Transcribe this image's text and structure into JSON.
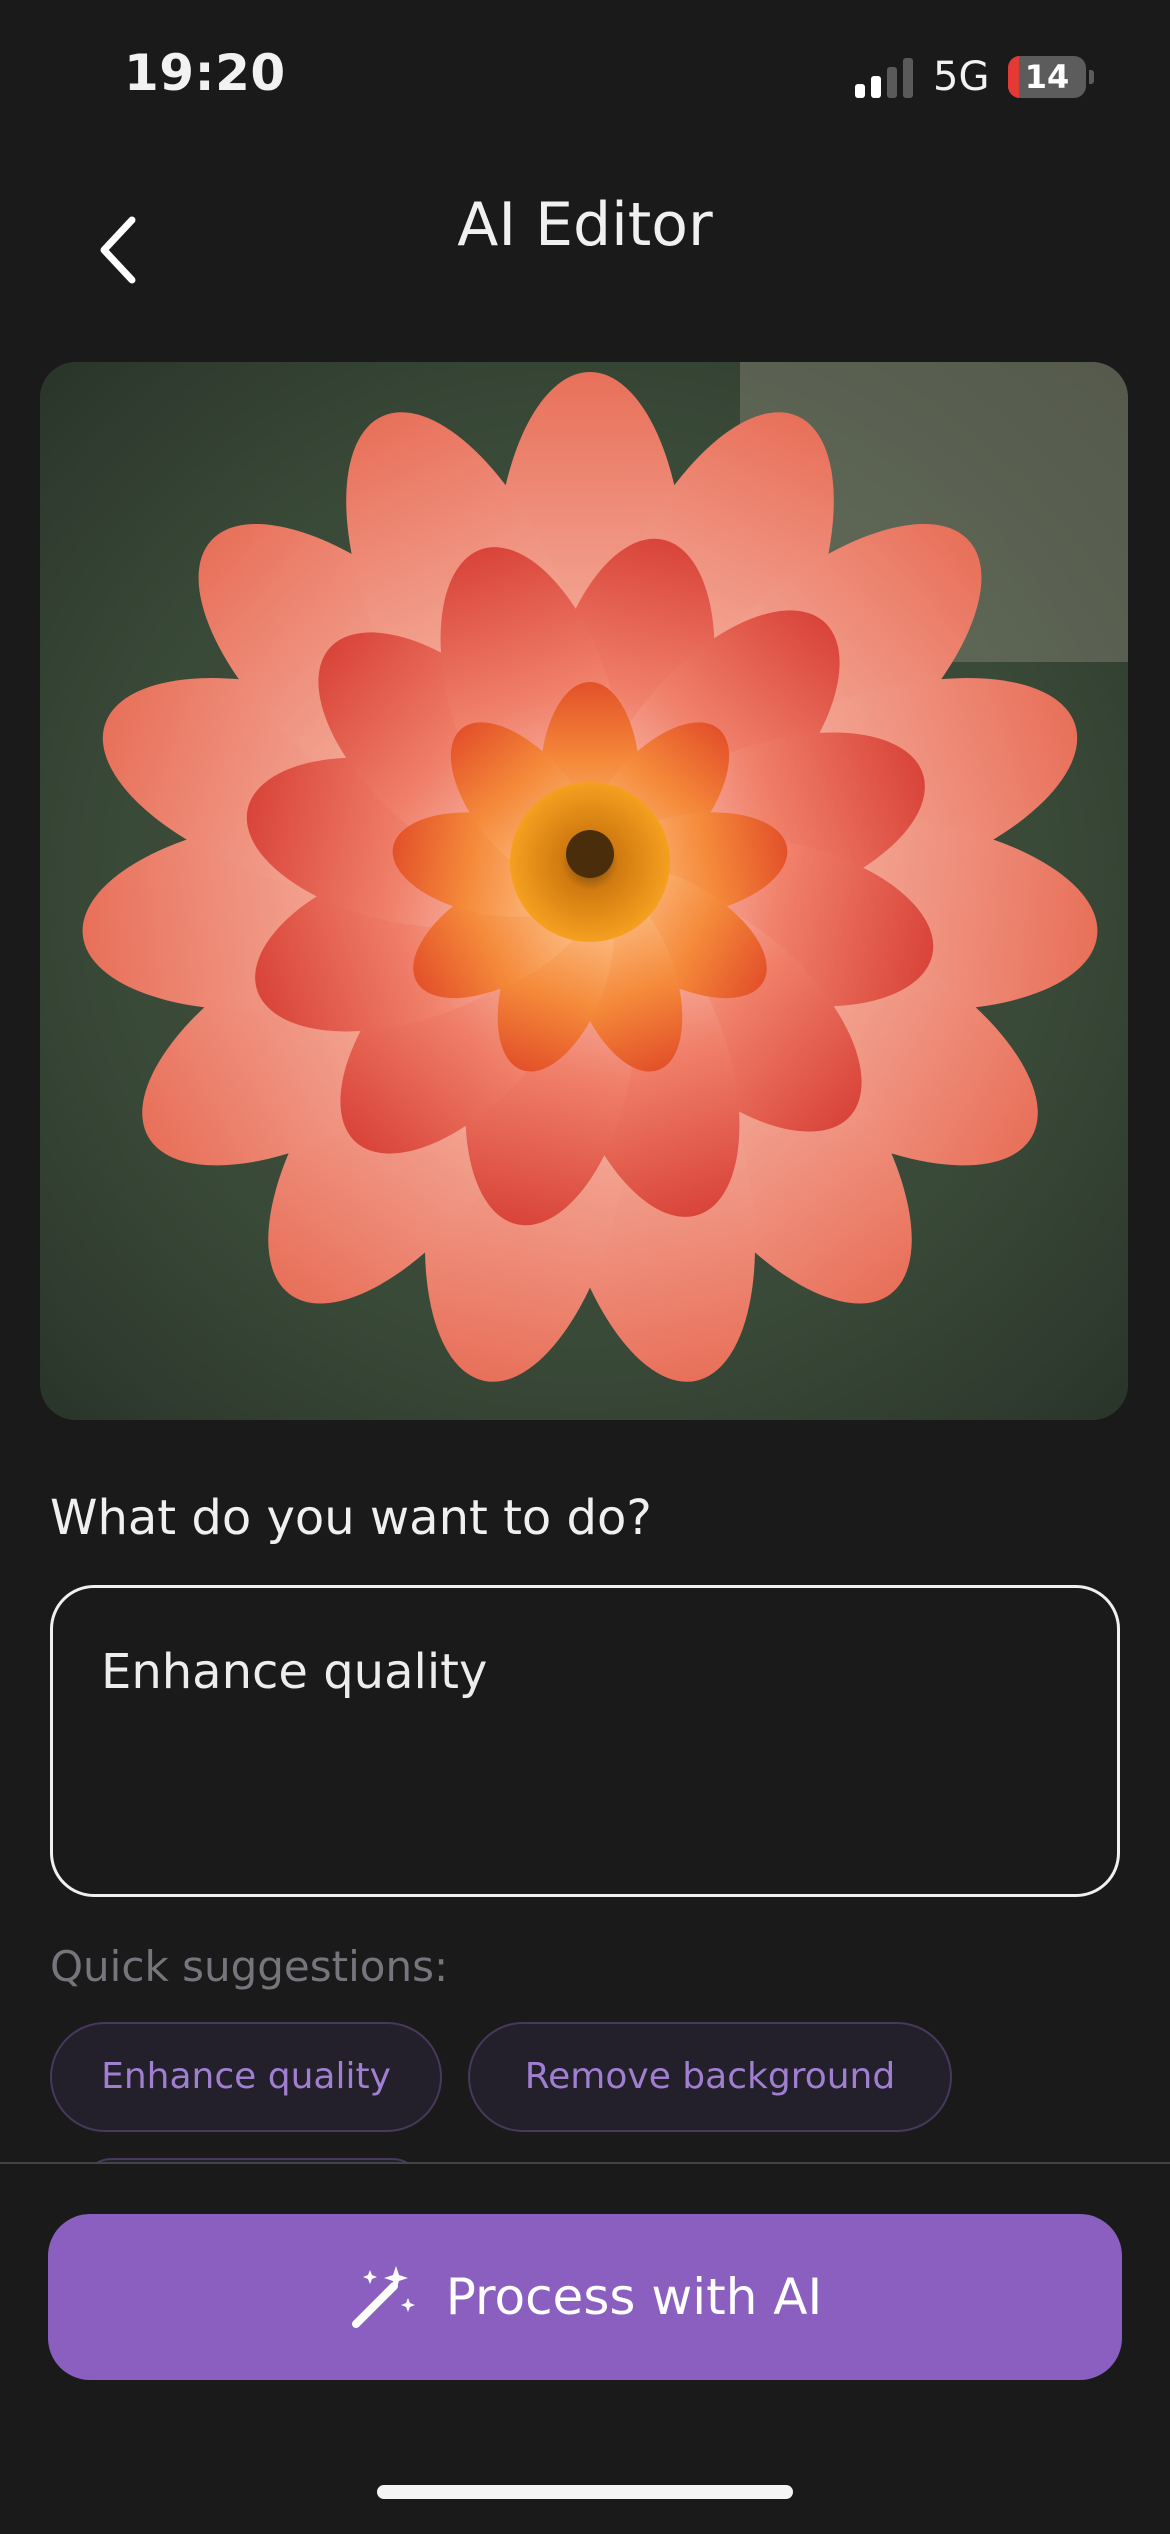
{
  "status_bar": {
    "time": "19:20",
    "network": "5G",
    "battery_level": "14",
    "battery_fraction": 0.14
  },
  "header": {
    "title": "AI Editor"
  },
  "preview": {
    "icon": "image-preview"
  },
  "prompt": {
    "label": "What do you want to do?",
    "value": "Enhance quality"
  },
  "suggestions": {
    "label": "Quick suggestions:",
    "items": [
      "Enhance quality",
      "Remove background"
    ]
  },
  "actions": {
    "process_label": "Process with AI"
  },
  "colors": {
    "background": "#1a1a1a",
    "accent": "#8b5fc0",
    "chip_text": "#a07fd0",
    "battery_low": "#e53935"
  }
}
